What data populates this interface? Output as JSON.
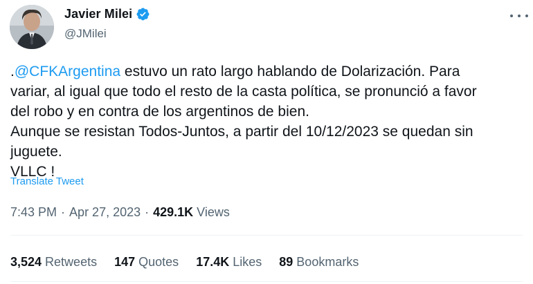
{
  "author": {
    "display_name": "Javier Milei",
    "handle": "@JMilei",
    "verified": true,
    "verified_icon": "verified-badge-icon",
    "accent_color": "#1d9bf0"
  },
  "tweet": {
    "prefix": ".",
    "mention": "@CFKArgentina",
    "text": " estuvo un rato largo hablando de Dolarización. Para\nvariar, al igual que todo el resto de la casta política, se pronunció a favor\ndel robo y en contra de los argentinos de bien.\nAunque se resistan Todos-Juntos, a partir del 10/12/2023 se quedan sin\njuguete.\nVLLC !",
    "translate_label": "Translate Tweet"
  },
  "meta": {
    "time": "7:43 PM",
    "separator": "·",
    "date": "Apr 27, 2023",
    "views_count": "429.1K",
    "views_label": "Views"
  },
  "stats": {
    "retweets_count": "3,524",
    "retweets_label": "Retweets",
    "quotes_count": "147",
    "quotes_label": "Quotes",
    "likes_count": "17.4K",
    "likes_label": "Likes",
    "bookmarks_count": "89",
    "bookmarks_label": "Bookmarks"
  },
  "colors": {
    "text": "#0f1419",
    "secondary": "#536471",
    "link": "#1d9bf0",
    "divider": "#eff3f4"
  }
}
